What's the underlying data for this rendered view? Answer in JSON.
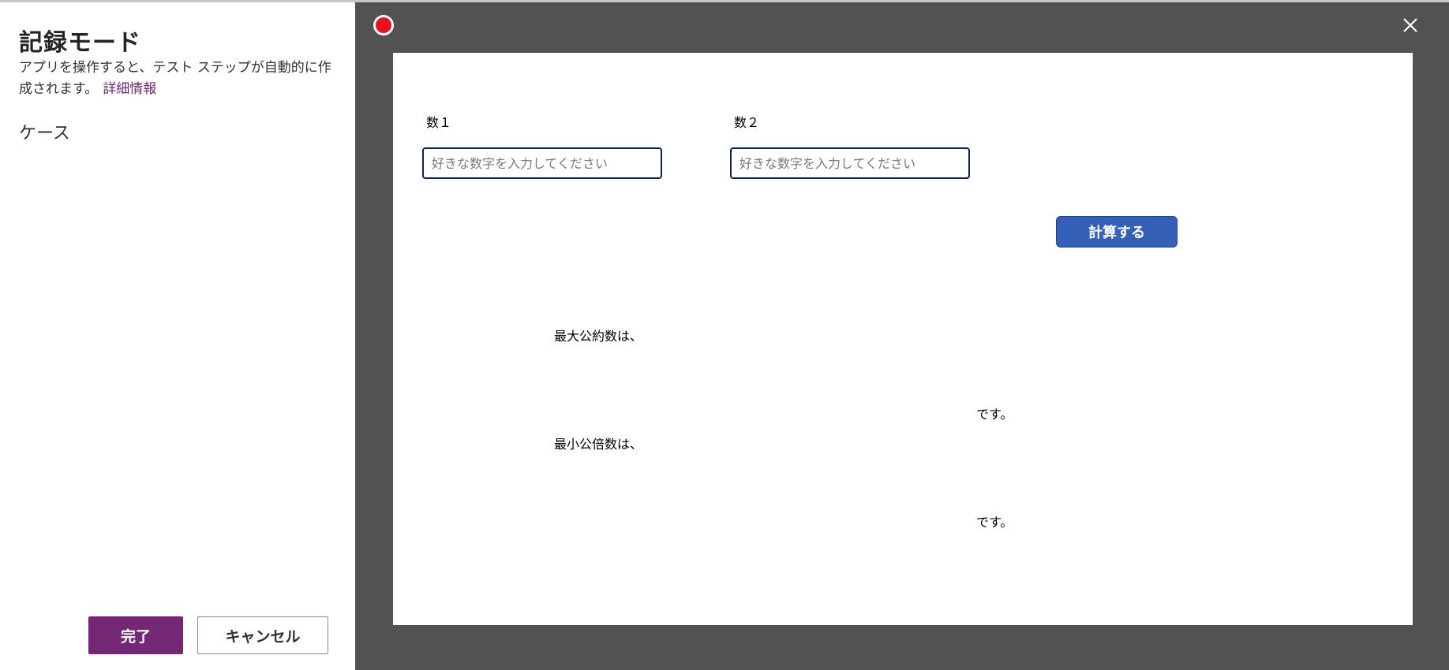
{
  "panel": {
    "title": "記録モード",
    "description": "アプリを操作すると、テスト ステップが自動的に作成されます。",
    "learn_more": "詳細情報",
    "case_label": "ケース",
    "done_label": "完了",
    "cancel_label": "キャンセル"
  },
  "recorder": {
    "indicator_color": "#e81123",
    "close_icon": "close-icon"
  },
  "app": {
    "num1_label": "数１",
    "num1_placeholder": "好きな数字を入力してください",
    "num2_label": "数２",
    "num2_placeholder": "好きな数字を入力してください",
    "calc_button": "計算する",
    "gcd_label": "最大公約数は、",
    "gcd_suffix": "です。",
    "lcm_label": "最小公倍数は、",
    "lcm_suffix": "です。"
  },
  "colors": {
    "accent_purple": "#742774",
    "button_blue": "#3460b8",
    "input_border": "#0f1f6b",
    "background_gray": "#525252"
  }
}
